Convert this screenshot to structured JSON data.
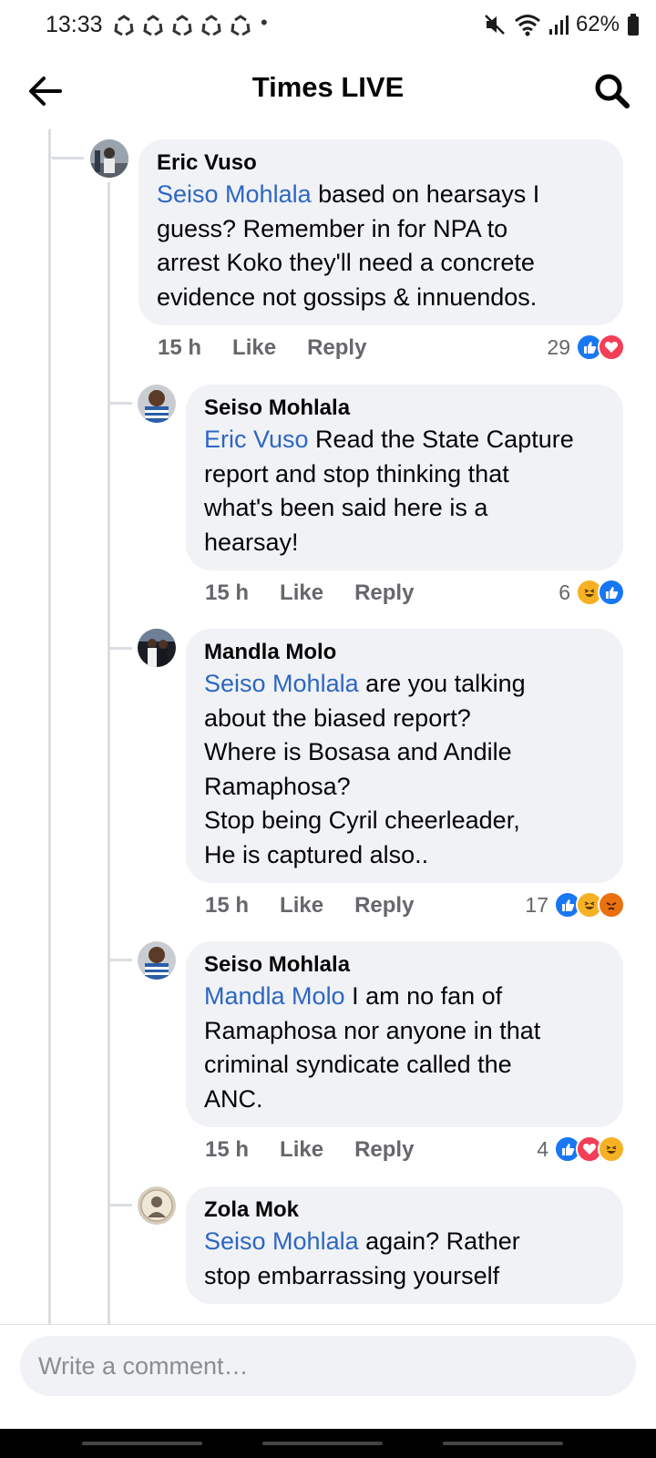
{
  "status_bar": {
    "time": "13:33",
    "battery": "62%",
    "left_icons": [
      "recycle-icon",
      "recycle-icon",
      "recycle-icon",
      "recycle-icon",
      "recycle-icon"
    ],
    "right_icons": [
      "mute-icon",
      "wifi-icon",
      "signal-icon",
      "battery-icon"
    ]
  },
  "header": {
    "title": "Times LIVE"
  },
  "comments": [
    {
      "author": "Eric Vuso",
      "mention": "Seiso Mohlala",
      "text": " based on hearsays I\nguess?  Remember in for NPA to\narrest Koko they'll need a concrete\nevidence not gossips & innuendos.",
      "time": "15 h",
      "like": "Like",
      "reply": "Reply",
      "reaction_count": "29",
      "reactions": [
        "like",
        "love"
      ]
    },
    {
      "author": "Seiso Mohlala",
      "mention": "Eric Vuso",
      "text": " Read the State Capture\nreport and stop thinking that\nwhat's been said here is a\nhearsay!",
      "time": "15 h",
      "like": "Like",
      "reply": "Reply",
      "reaction_count": "6",
      "reactions": [
        "haha",
        "like"
      ]
    },
    {
      "author": "Mandla Molo",
      "mention": "Seiso Mohlala",
      "text": " are you talking\nabout the biased report?\nWhere is Bosasa and Andile\nRamaphosa?\nStop being Cyril cheerleader,\nHe is captured also..",
      "time": "15 h",
      "like": "Like",
      "reply": "Reply",
      "reaction_count": "17",
      "reactions": [
        "like",
        "haha",
        "angry"
      ]
    },
    {
      "author": "Seiso Mohlala",
      "mention": "Mandla Molo",
      "text": " I am no fan of\nRamaphosa nor anyone in that\ncriminal syndicate called the\nANC.",
      "time": "15 h",
      "like": "Like",
      "reply": "Reply",
      "reaction_count": "4",
      "reactions": [
        "like",
        "love",
        "haha"
      ]
    },
    {
      "author": "Zola Mok",
      "mention": "Seiso Mohlala",
      "text": " again? Rather\nstop embarrassing yourself"
    }
  ],
  "composer": {
    "placeholder": "Write a comment…"
  }
}
